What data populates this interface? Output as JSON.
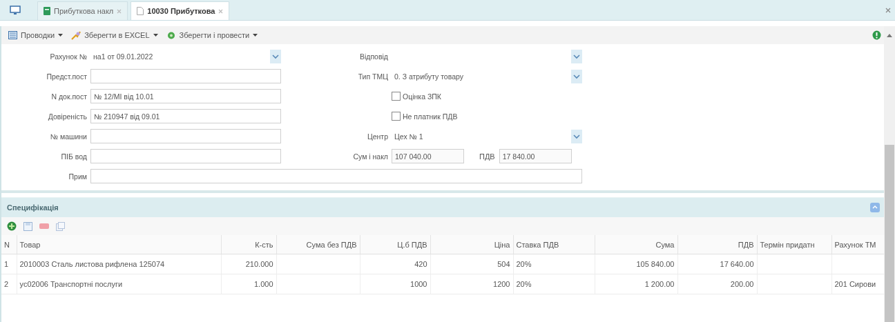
{
  "tabs": [
    {
      "label": "Прибуткова накл",
      "kind": "list",
      "selected": false
    },
    {
      "label": "10030 Прибуткова",
      "kind": "document",
      "selected": true
    }
  ],
  "toolbar": [
    {
      "label": "Проводки",
      "kind": "postings"
    },
    {
      "label": "Зберегти в EXCEL",
      "kind": "excel"
    },
    {
      "label": "Зберегти і провести",
      "kind": "post"
    }
  ],
  "form": {
    "left": [
      {
        "label": "Рахунок №",
        "value": "на1 от 09.01.2022",
        "kind": "combo"
      },
      {
        "label": "Предст.пост",
        "kind": "text"
      },
      {
        "label": "N док.пост",
        "value": "№ 12/МІ від 10.01",
        "kind": "text"
      },
      {
        "label": "Довіреність",
        "value": "№ 210947 від 09.01",
        "kind": "text"
      },
      {
        "label": "№ машини",
        "kind": "text"
      },
      {
        "label": "ПІБ вод",
        "kind": "text"
      }
    ],
    "right": [
      {
        "kind": "combo",
        "label": "Відповід"
      },
      {
        "kind": "combo",
        "label": "Тип ТМЦ",
        "value": "0. З атрибуту товару"
      },
      {
        "kind": "checkbox",
        "label": "Оцінка ЗПК",
        "checked": false
      },
      {
        "kind": "checkbox",
        "label": "Не платник ПДВ",
        "checked": false
      },
      {
        "kind": "combo",
        "label": "Центр",
        "value": "Цех № 1"
      },
      {
        "kind": "sums",
        "label": "Сум і накл",
        "value": "107 040.00",
        "label2": "ПДВ",
        "value2": "17 840.00"
      }
    ],
    "note": {
      "label": "Прим"
    }
  },
  "spec": {
    "title": "Специфікація",
    "columns": [
      {
        "label": "N",
        "numeric": false
      },
      {
        "label": "Товар",
        "numeric": false
      },
      {
        "label": "К-сть",
        "numeric": true
      },
      {
        "label": "Сума без ПДВ",
        "numeric": true
      },
      {
        "label": "Ц.б ПДВ",
        "numeric": true
      },
      {
        "label": "Ціна",
        "numeric": true
      },
      {
        "label": "Ставка ПДВ",
        "numeric": false
      },
      {
        "label": "Сума",
        "numeric": true
      },
      {
        "label": "ПДВ",
        "numeric": true
      },
      {
        "label": "Термін придатн",
        "numeric": false
      },
      {
        "label": "Рахунок ТМ",
        "numeric": false
      }
    ],
    "rows": [
      [
        "1",
        "2010003 Сталь листова рифлена 125074",
        "210.000",
        "",
        "420",
        "504",
        "20%",
        "105 840.00",
        "17 640.00",
        "",
        ""
      ],
      [
        "2",
        "ус02006 Транспортні послуги",
        "1.000",
        "",
        "1000",
        "1200",
        "20%",
        "1 200.00",
        "200.00",
        "",
        "201 Сирови"
      ]
    ]
  }
}
